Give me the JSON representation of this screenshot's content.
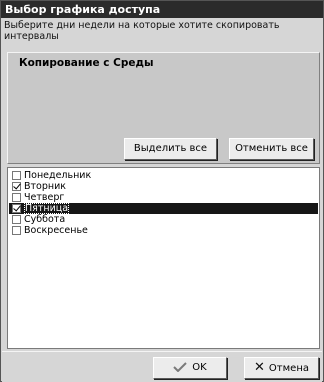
{
  "window": {
    "title": "Выбор графика доступа"
  },
  "instruction": "Выберите дни недели  на которые хотите скопировать интервалы",
  "copy_panel": {
    "title": "Копирование с Среды",
    "select_all_label": "Выделить все",
    "deselect_all_label": "Отменить все"
  },
  "days": [
    {
      "label": "Понедельник",
      "checked": false,
      "selected": false
    },
    {
      "label": "Вторник",
      "checked": true,
      "selected": false
    },
    {
      "label": "Четверг",
      "checked": false,
      "selected": false
    },
    {
      "label": "Пятница",
      "checked": true,
      "selected": true
    },
    {
      "label": "Суббота",
      "checked": false,
      "selected": false
    },
    {
      "label": "Воскресенье",
      "checked": false,
      "selected": false
    }
  ],
  "footer": {
    "ok_label": "OK",
    "cancel_label": "Отмена",
    "ok_icon": "checkmark-icon",
    "cancel_icon": "x-icon"
  }
}
